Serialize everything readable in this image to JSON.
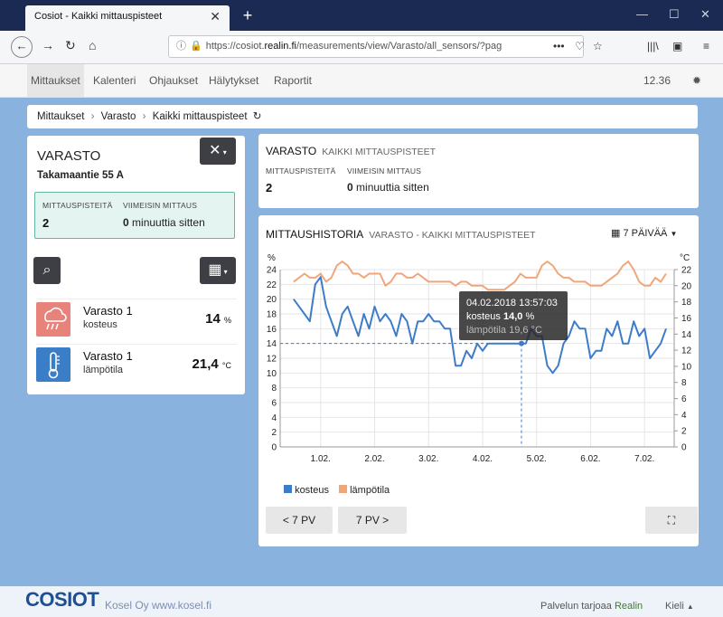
{
  "browser": {
    "tab_title": "Cosiot - Kaikki mittauspisteet",
    "url_prefix": "https://cosiot.",
    "url_domain": "realin.fi",
    "url_rest": "/measurements/view/Varasto/all_sensors/?pag"
  },
  "nav": {
    "items": [
      "Mittaukset",
      "Kalenteri",
      "Ohjaukset",
      "Hälytykset",
      "Raportit"
    ],
    "active": "Mittaukset",
    "time": "12.36"
  },
  "breadcrumb": [
    "Mittaukset",
    "Varasto",
    "Kaikki mittauspisteet"
  ],
  "location": {
    "name": "VARASTO",
    "address": "Takamaantie 55 A",
    "stat_label_points": "Mittauspisteitä",
    "stat_label_last": "Viimeisin mittaus",
    "points": "2",
    "last_num": "0",
    "last_text": "minuuttia sitten"
  },
  "sensors": [
    {
      "name": "Varasto 1",
      "type": "kosteus",
      "value": "14",
      "unit": "%",
      "color": "#e8837b"
    },
    {
      "name": "Varasto 1",
      "type": "lämpötila",
      "value": "21,4",
      "unit": "°C",
      "color": "#3a7ec7"
    }
  ],
  "summary": {
    "title": "VARASTO",
    "subtitle": "KAIKKI MITTAUSPISTEET",
    "label_points": "Mittauspisteitä",
    "label_last": "Viimeisin mittaus",
    "points": "2",
    "last_num": "0",
    "last_text": "minuuttia sitten"
  },
  "history": {
    "title": "MITTAUSHISTORIA",
    "subtitle": "VARASTO - KAIKKI MITTAUSPISTEET",
    "range_label": "7 PÄIVÄÄ",
    "prev_label": "< 7 PV",
    "next_label": "7 PV >"
  },
  "chart_data": {
    "type": "line",
    "x_ticks": [
      "1.02.",
      "2.02.",
      "3.02.",
      "4.02.",
      "5.02.",
      "6.02.",
      "7.02."
    ],
    "left_unit": "%",
    "right_unit": "°C",
    "ylim_left": [
      0,
      24
    ],
    "ylim_right": [
      0,
      22
    ],
    "grid": true,
    "legend_position": "bottom-left",
    "series": [
      {
        "name": "kosteus",
        "axis": "left",
        "color": "#3d7cc9",
        "x": [
          0.5,
          0.6,
          0.7,
          0.8,
          0.9,
          1.0,
          1.1,
          1.2,
          1.3,
          1.4,
          1.5,
          1.6,
          1.7,
          1.8,
          1.9,
          2.0,
          2.1,
          2.2,
          2.3,
          2.4,
          2.5,
          2.6,
          2.7,
          2.8,
          2.9,
          3.0,
          3.1,
          3.2,
          3.3,
          3.4,
          3.5,
          3.6,
          3.7,
          3.8,
          3.9,
          4.0,
          4.1,
          4.2,
          4.3,
          4.4,
          4.5,
          4.6,
          4.7,
          4.8,
          4.9,
          5.0,
          5.1,
          5.2,
          5.3,
          5.4,
          5.5,
          5.6,
          5.7,
          5.8,
          5.9,
          6.0,
          6.1,
          6.2,
          6.3,
          6.4,
          6.5,
          6.6,
          6.7,
          6.8,
          6.9,
          7.0,
          7.1,
          7.2,
          7.3,
          7.4
        ],
        "y": [
          20,
          19,
          18,
          17,
          22,
          23,
          19,
          17,
          15,
          18,
          19,
          17,
          15,
          18,
          16,
          19,
          17,
          18,
          17,
          15,
          18,
          17,
          14,
          17,
          17,
          18,
          17,
          17,
          16,
          16,
          11,
          11,
          13,
          12,
          14,
          13,
          14,
          14,
          14,
          14,
          14,
          14,
          14,
          14,
          16,
          15,
          15,
          11,
          10,
          11,
          14,
          15,
          17,
          16,
          16,
          12,
          13,
          13,
          16,
          15,
          17,
          14,
          14,
          17,
          15,
          16,
          12,
          13,
          14,
          16
        ]
      },
      {
        "name": "lämpötila",
        "axis": "right",
        "color": "#f0a678",
        "x": [
          0.5,
          0.6,
          0.7,
          0.8,
          0.9,
          1.0,
          1.1,
          1.2,
          1.3,
          1.4,
          1.5,
          1.6,
          1.7,
          1.8,
          1.9,
          2.0,
          2.1,
          2.2,
          2.3,
          2.4,
          2.5,
          2.6,
          2.7,
          2.8,
          2.9,
          3.0,
          3.1,
          3.2,
          3.3,
          3.4,
          3.5,
          3.6,
          3.7,
          3.8,
          3.9,
          4.0,
          4.1,
          4.2,
          4.3,
          4.4,
          4.5,
          4.6,
          4.7,
          4.8,
          4.9,
          5.0,
          5.1,
          5.2,
          5.3,
          5.4,
          5.5,
          5.6,
          5.7,
          5.8,
          5.9,
          6.0,
          6.1,
          6.2,
          6.3,
          6.4,
          6.5,
          6.6,
          6.7,
          6.8,
          6.9,
          7.0,
          7.1,
          7.2,
          7.3,
          7.4
        ],
        "y": [
          20.5,
          21,
          21.5,
          21,
          21,
          21.5,
          20.5,
          21,
          22.5,
          23,
          22.5,
          21.5,
          21.5,
          21,
          21.5,
          21.5,
          21.5,
          20,
          20.5,
          21.5,
          21.5,
          21,
          21,
          21.5,
          21,
          20.5,
          20.5,
          20.5,
          20.5,
          20.5,
          20,
          20.5,
          20.5,
          20,
          20,
          20,
          19.5,
          19.5,
          19.5,
          19.5,
          20,
          20.5,
          21.5,
          21,
          21,
          21,
          22.5,
          23,
          22.5,
          21.5,
          21,
          21,
          20.5,
          20.5,
          20.5,
          20,
          20,
          20,
          20.5,
          21,
          21.5,
          22.5,
          23,
          22,
          20.5,
          20,
          20,
          21,
          20.5,
          21.5
        ]
      }
    ],
    "tooltip": {
      "time": "04.02.2018 13:57:03",
      "row1_label": "kosteus",
      "row1_value": "14,0",
      "row1_unit": "%",
      "row2_label": "lämpötila",
      "row2_value": "19,6",
      "row2_unit": "°C",
      "x": 4.72,
      "y": 14
    }
  },
  "footer": {
    "brand": "COSIOT",
    "brand_sub": "Kosel Oy  www.kosel.fi",
    "provider_prefix": "Palvelun tarjoaa",
    "provider_name": "Realin",
    "language": "Kieli"
  }
}
